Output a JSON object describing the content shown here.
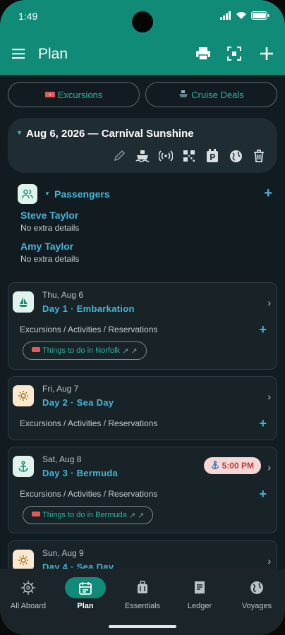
{
  "status": {
    "time": "1:49"
  },
  "appbar": {
    "title": "Plan"
  },
  "quick_links": [
    {
      "label": "Excursions",
      "icon": "ticket-icon"
    },
    {
      "label": "Cruise Deals",
      "icon": "ship-icon"
    }
  ],
  "trip": {
    "title": "Aug 6, 2026 — Carnival Sunshine"
  },
  "passengers": {
    "title": "Passengers",
    "people": [
      {
        "name": "Steve Taylor",
        "detail": "No extra details"
      },
      {
        "name": "Amy Taylor",
        "detail": "No extra details"
      }
    ]
  },
  "days": [
    {
      "date": "Thu, Aug 6",
      "title": "Day 1 · Embarkation",
      "icon": "sailboat-icon",
      "sub": "Excursions / Activities / Reservations",
      "link": "Things to do in Norfolk"
    },
    {
      "date": "Fri, Aug 7",
      "title": "Day 2 · Sea Day",
      "icon": "sun-icon",
      "sub": "Excursions / Activities / Reservations"
    },
    {
      "date": "Sat, Aug 8",
      "title": "Day 3 · Bermuda",
      "icon": "anchor-icon",
      "sub": "Excursions / Activities / Reservations",
      "link": "Things to do in Bermuda",
      "badge": "5:00 PM"
    },
    {
      "date": "Sun, Aug 9",
      "title": "Day 4 · Sea Day",
      "icon": "sun-icon"
    }
  ],
  "nav": [
    {
      "label": "All Aboard",
      "icon": "ship-wheel-icon"
    },
    {
      "label": "Plan",
      "icon": "calendar-icon",
      "active": true
    },
    {
      "label": "Essentials",
      "icon": "luggage-icon"
    },
    {
      "label": "Ledger",
      "icon": "receipt-icon"
    },
    {
      "label": "Voyages",
      "icon": "globe-icon"
    }
  ],
  "colors": {
    "primary": "#0f8b78",
    "accent": "#45b4d6",
    "background": "#121c20",
    "badge": "#c23a3a"
  }
}
